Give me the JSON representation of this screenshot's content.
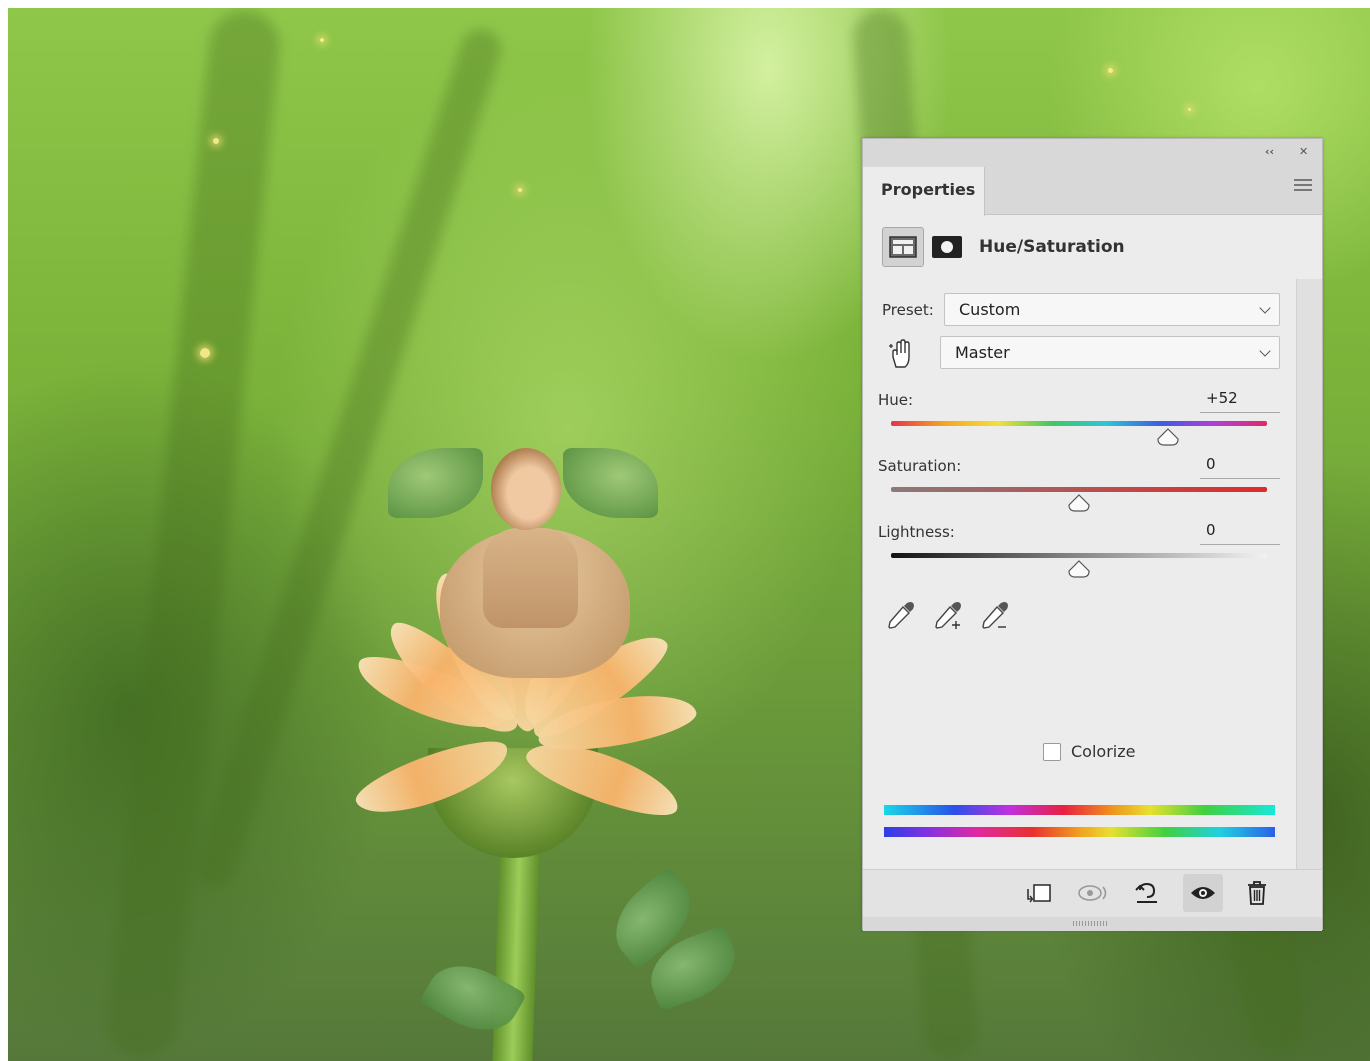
{
  "panel": {
    "collapse_glyph": "‹‹",
    "close_glyph": "✕",
    "tab_label": "Properties",
    "adjustment_title": "Hue/Saturation",
    "preset_label": "Preset:",
    "preset_value": "Custom",
    "channel_value": "Master",
    "hue_label": "Hue:",
    "hue_value": "+52",
    "hue_fraction": 0.738,
    "saturation_label": "Saturation:",
    "saturation_value": "0",
    "saturation_fraction": 0.5,
    "lightness_label": "Lightness:",
    "lightness_value": "0",
    "lightness_fraction": 0.5,
    "colorize_label": "Colorize",
    "colorize_checked": false
  },
  "icons": {
    "adjustment": "hue-saturation-icon",
    "mask": "layer-mask-icon",
    "target": "targeted-adjustment-hand-icon",
    "eyedroppers": [
      "eyedropper-icon",
      "eyedropper-plus-icon",
      "eyedropper-minus-icon"
    ],
    "footer": [
      "clip-to-layer-icon",
      "view-previous-state-icon",
      "reset-icon",
      "visibility-eye-icon",
      "trash-icon"
    ]
  },
  "colors": {
    "panel_bg": "#ececec",
    "hue_gradient": [
      "#e8324a",
      "#f5a623",
      "#f2e03a",
      "#40c860",
      "#2ec5d8",
      "#3a5fe0",
      "#b03ed8",
      "#e02a6a"
    ],
    "saturation_end": "#e02a2a"
  }
}
